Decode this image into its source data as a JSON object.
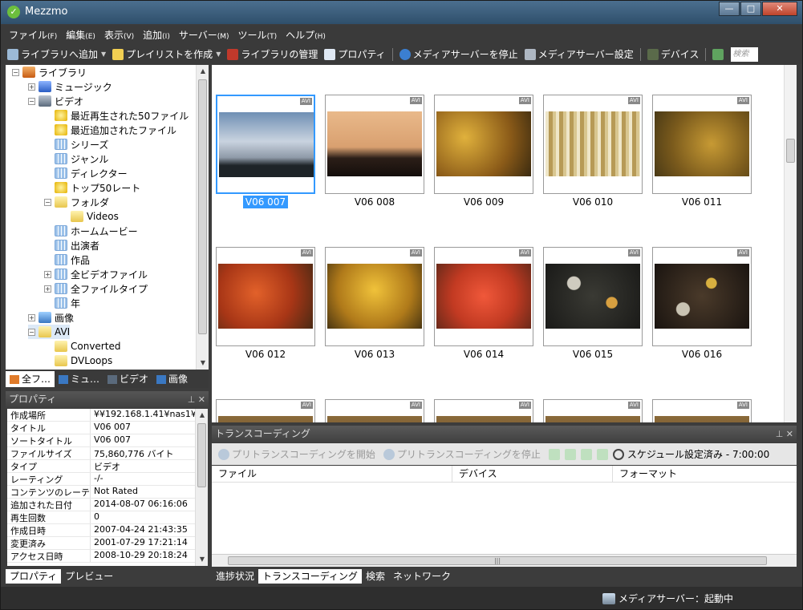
{
  "window": {
    "title": "Mezzmo",
    "controls": [
      "minimize",
      "maximize",
      "close"
    ]
  },
  "menu": [
    {
      "label": "ファイル",
      "accel": "(F)"
    },
    {
      "label": "編集",
      "accel": "(E)"
    },
    {
      "label": "表示",
      "accel": "(V)"
    },
    {
      "label": "追加",
      "accel": "(I)"
    },
    {
      "label": "サーバー",
      "accel": "(M)"
    },
    {
      "label": "ツール",
      "accel": "(T)"
    },
    {
      "label": "ヘルプ",
      "accel": "(H)"
    }
  ],
  "toolbar": {
    "add_library": "ライブラリへ追加",
    "create_playlist": "プレイリストを作成",
    "manage_library": "ライブラリの管理",
    "properties": "プロパティ",
    "stop_media_server": "メディアサーバーを停止",
    "media_server_settings": "メディアサーバー設定",
    "devices": "デバイス",
    "search_placeholder": "検索"
  },
  "tree": [
    {
      "label": "ライブラリ",
      "icon": "home-icon",
      "exp": "−"
    },
    {
      "label": "ミュージック",
      "icon": "music-icon",
      "exp": "+"
    },
    {
      "label": "ビデオ",
      "icon": "video-icon",
      "exp": "−"
    },
    {
      "label": "最近再生された50ファイル",
      "icon": "smart-playlist-icon",
      "exp": ""
    },
    {
      "label": "最近追加されたファイル",
      "icon": "smart-playlist-icon",
      "exp": ""
    },
    {
      "label": "シリーズ",
      "icon": "category-icon",
      "exp": ""
    },
    {
      "label": "ジャンル",
      "icon": "category-icon",
      "exp": ""
    },
    {
      "label": "ディレクター",
      "icon": "category-icon",
      "exp": ""
    },
    {
      "label": "トップ50レート",
      "icon": "smart-playlist-icon",
      "exp": ""
    },
    {
      "label": "フォルダ",
      "icon": "folder-icon",
      "exp": "−"
    },
    {
      "label": "Videos",
      "icon": "folder-icon",
      "exp": ""
    },
    {
      "label": "ホームムービー",
      "icon": "category-icon",
      "exp": ""
    },
    {
      "label": "出演者",
      "icon": "category-icon",
      "exp": ""
    },
    {
      "label": "作品",
      "icon": "category-icon",
      "exp": ""
    },
    {
      "label": "全ビデオファイル",
      "icon": "category-icon",
      "exp": "+"
    },
    {
      "label": "全ファイルタイプ",
      "icon": "category-icon",
      "exp": "+"
    },
    {
      "label": "年",
      "icon": "category-icon",
      "exp": ""
    },
    {
      "label": "画像",
      "icon": "image-icon",
      "exp": "+"
    },
    {
      "label": "AVI",
      "icon": "folder-icon",
      "exp": "−"
    },
    {
      "label": "Converted",
      "icon": "folder-icon",
      "exp": ""
    },
    {
      "label": "DVLoops",
      "icon": "folder-icon",
      "exp": ""
    }
  ],
  "library_tabs": [
    "全フ…",
    "ミュ…",
    "ビデオ",
    "画像"
  ],
  "properties": {
    "title": "プロパティ",
    "rows": [
      {
        "k": "作成場所",
        "v": "¥¥192.168.1.41¥nas1¥…"
      },
      {
        "k": "タイトル",
        "v": "V06 007"
      },
      {
        "k": "ソートタイトル",
        "v": "V06 007"
      },
      {
        "k": "ファイルサイズ",
        "v": "75,860,776 バイト"
      },
      {
        "k": "タイプ",
        "v": "ビデオ"
      },
      {
        "k": "レーティング",
        "v": "-/-"
      },
      {
        "k": "コンテンツのレーテ…",
        "v": "Not Rated"
      },
      {
        "k": "追加された日付",
        "v": "2014-08-07 06:16:06"
      },
      {
        "k": "再生回数",
        "v": "0"
      },
      {
        "k": "作成日時",
        "v": "2007-04-24 21:43:35"
      },
      {
        "k": "変更済み",
        "v": "2001-07-29 17:21:14"
      },
      {
        "k": "アクセス日時",
        "v": "2008-10-29 20:18:24"
      }
    ],
    "tabs": [
      "プロパティ",
      "プレビュー"
    ]
  },
  "grid": {
    "badge": "AVI",
    "items": [
      {
        "label": "V06 007",
        "scene": "sky"
      },
      {
        "label": "V06 008",
        "scene": "sunset"
      },
      {
        "label": "V06 009",
        "scene": "autumn-gold"
      },
      {
        "label": "V06 010",
        "scene": "birch"
      },
      {
        "label": "V06 011",
        "scene": "autumn-olive"
      },
      {
        "label": "V06 012",
        "scene": "autumn-red"
      },
      {
        "label": "V06 013",
        "scene": "autumn-yellow"
      },
      {
        "label": "V06 014",
        "scene": "maple-red"
      },
      {
        "label": "V06 015",
        "scene": "leaves-dark"
      },
      {
        "label": "V06 016",
        "scene": "leaves-dark2"
      }
    ],
    "selected": "V06 007"
  },
  "transcoding": {
    "title": "トランスコーディング",
    "start": "プリトランスコーディングを開始",
    "stop": "プリトランスコーディングを停止",
    "schedule": "スケジュール設定済み - 7:00:00",
    "columns": [
      "ファイル",
      "デバイス",
      "フォーマット"
    ]
  },
  "bottom_tabs": [
    "進捗状況",
    "トランスコーディング",
    "検索",
    "ネットワーク"
  ],
  "status": {
    "text": "メディアサーバー：起動中"
  }
}
